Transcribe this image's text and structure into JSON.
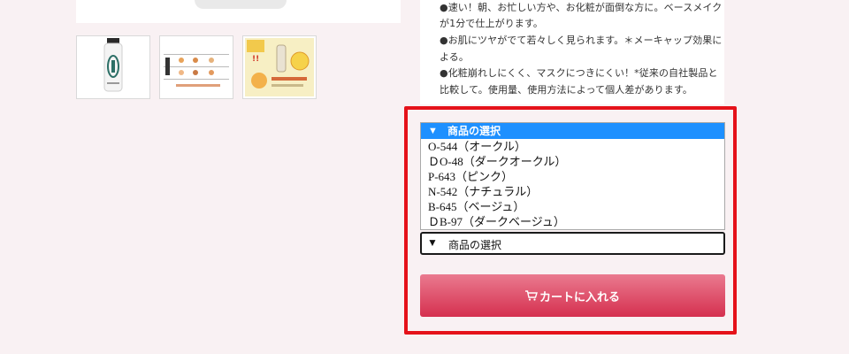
{
  "gallery": {
    "main_image_icon": "product-bottle-image",
    "thumbnails": [
      {
        "icon": "bottle-thumbnail"
      },
      {
        "icon": "color-chart-thumbnail"
      },
      {
        "icon": "promo-flyer-thumbnail"
      }
    ]
  },
  "description": {
    "lines": [
      "●速い！朝、お忙しい方や、お化粧が面倒な方に。ベースメイク",
      "が1分で仕上がります。",
      "●お肌にツヤがでて若々しく見られます。＊メーキャップ効果に",
      "よる。",
      "●化粧崩れしにくく、マスクにつきにくい！*従来の自社製品と",
      "比較して。使用量、使用方法によって個人差があります。"
    ]
  },
  "product_select": {
    "arrow": "▼",
    "placeholder": "商品の選択",
    "options": [
      "O-544（オークル）",
      "ＤO-48（ダークオークル）",
      "P-643（ピンク）",
      "N-542（ナチュラル）",
      "B-645（ベージュ）",
      "ＤB-97（ダークベージュ）"
    ]
  },
  "cart_button": {
    "label": "カートに入れる",
    "icon": "cart-icon"
  },
  "colors": {
    "highlight": "#e5121a",
    "select_highlight": "#1e90ff",
    "cart_button_top": "#ea7a8f",
    "cart_button_bottom": "#d5304f",
    "page_background": "#f9f1f3"
  }
}
